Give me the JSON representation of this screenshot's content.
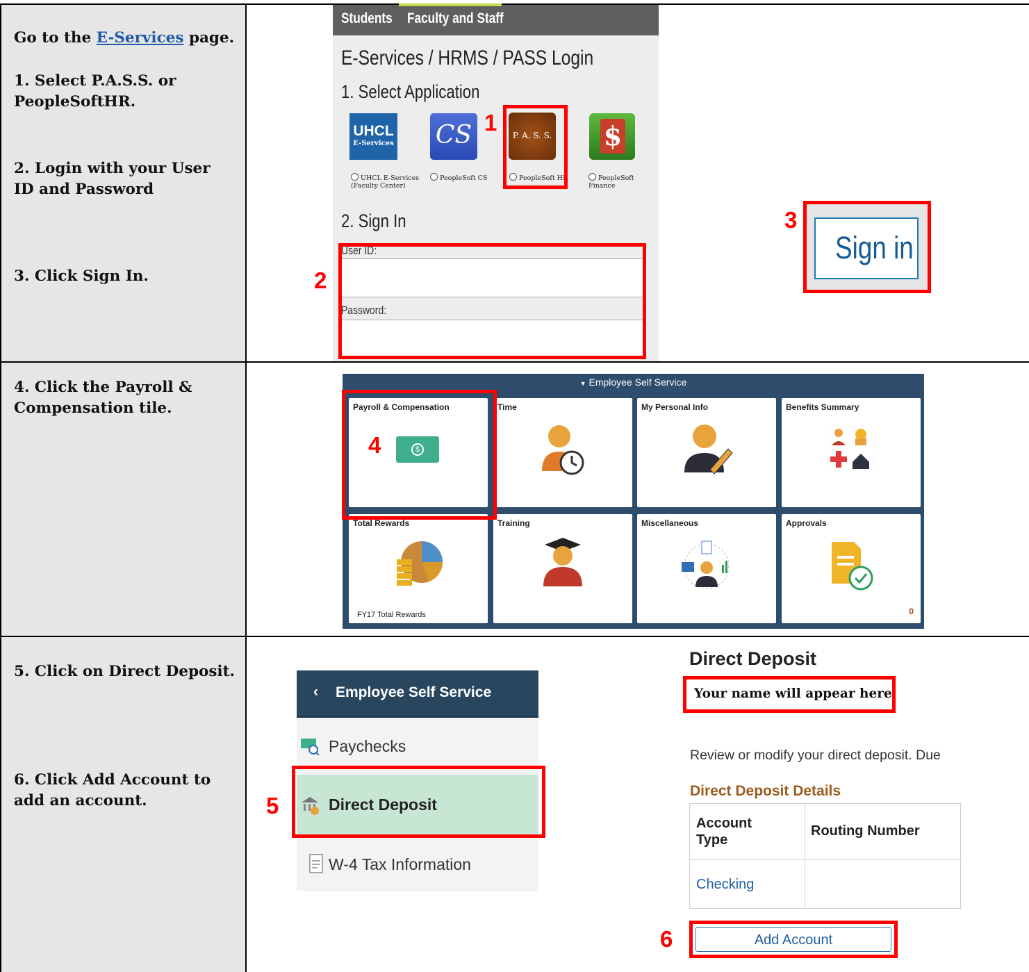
{
  "instructions": {
    "row1": {
      "go_to_prefix": "Go to the ",
      "go_to_link": "E-Services",
      "go_to_suffix": " page.",
      "step1": "1.  Select P.A.S.S. or PeopleSoftHR.",
      "step2": "2.  Login with your User ID and Password",
      "step3": "3.  Click Sign In."
    },
    "row2": {
      "step4": "4.  Click the Payroll & Compensation tile."
    },
    "row3": {
      "step5": "5.  Click on Direct Deposit.",
      "step6": "6.  Click Add Account to add an account."
    }
  },
  "login": {
    "tabs": [
      "Students",
      "Faculty and Staff"
    ],
    "title": "E-Services / HRMS / PASS Login",
    "select_heading": "1. Select Application",
    "apps": [
      {
        "logo": "UHCL",
        "logo_sub": "E-Services",
        "label": "UHCL E-Services",
        "label2": "(Faculty Center)"
      },
      {
        "logo": "CS",
        "label": "PeopleSoft CS"
      },
      {
        "logo": "P. A. S. S.",
        "label": "PeopleSoft HR"
      },
      {
        "logo": "$",
        "label": "PeopleSoft Finance"
      }
    ],
    "sign_in_heading": "2. Sign In",
    "user_id_label": "User ID:",
    "password_label": "Password:",
    "sign_in_button": "Sign in"
  },
  "callouts": {
    "n1": "1",
    "n2": "2",
    "n3": "3",
    "n4": "4",
    "n5": "5",
    "n6": "6"
  },
  "ess": {
    "header": "Employee Self Service",
    "tiles": [
      {
        "label": "Payroll & Compensation",
        "icon": "money-icon"
      },
      {
        "label": "Time",
        "icon": "person-clock-icon"
      },
      {
        "label": "My Personal Info",
        "icon": "person-edit-icon"
      },
      {
        "label": "Benefits Summary",
        "icon": "benefits-icon"
      },
      {
        "label": "Total Rewards",
        "icon": "pie-chart-coins-icon",
        "footer": "FY17 Total Rewards"
      },
      {
        "label": "Training",
        "icon": "graduate-icon"
      },
      {
        "label": "Miscellaneous",
        "icon": "misc-icon"
      },
      {
        "label": "Approvals",
        "icon": "approval-doc-icon",
        "count": "0"
      }
    ]
  },
  "nav": {
    "back_label": "Employee Self Service",
    "items": [
      "Paychecks",
      "Direct Deposit",
      "W-4 Tax Information"
    ]
  },
  "direct_deposit": {
    "title": "Direct Deposit",
    "name_placeholder": "Your name will appear here",
    "description": "Review or modify your direct deposit. Due",
    "details_heading": "Direct Deposit Details",
    "columns": [
      "Account Type",
      "Routing Number"
    ],
    "rows": [
      [
        "Checking",
        ""
      ]
    ],
    "add_account_button": "Add Account"
  },
  "colors": {
    "red": "#ff0000",
    "login_bg": "#ededed",
    "tab_bar": "#5f5f5f",
    "ess_bg": "#2e4d6c",
    "nav_header": "#29465f",
    "selected_nav": "#c8e6d4",
    "dd_heading": "#9b5b1f",
    "link": "#1f5fa6"
  }
}
